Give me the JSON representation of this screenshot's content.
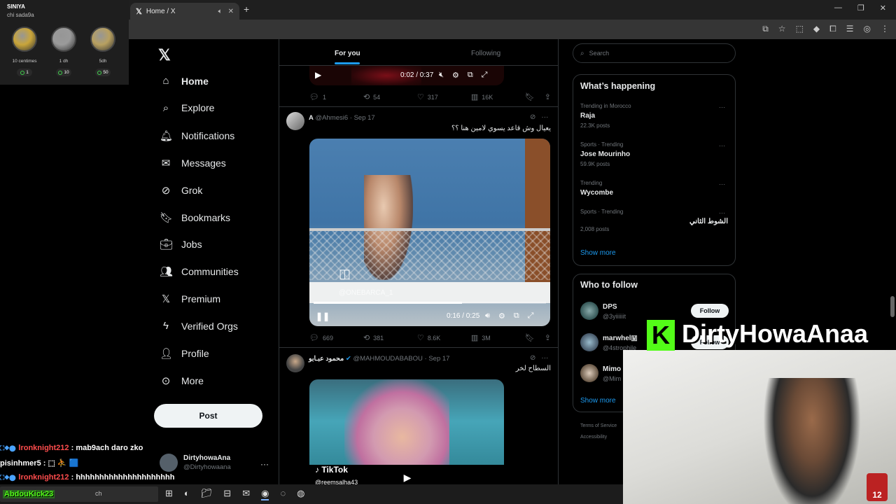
{
  "browser": {
    "tab_title": "Home / X",
    "tab_logo": "𝕏",
    "new_tab": "+",
    "window_controls": [
      "—",
      "❐",
      "✕"
    ]
  },
  "sidebar": {
    "logo": "𝕏",
    "items": [
      {
        "label": "Home",
        "icon": "home-icon",
        "glyph": "⌂",
        "active": true
      },
      {
        "label": "Explore",
        "icon": "search-icon",
        "glyph": "⌕"
      },
      {
        "label": "Notifications",
        "icon": "bell-icon",
        "glyph": "🔔︎"
      },
      {
        "label": "Messages",
        "icon": "mail-icon",
        "glyph": "✉"
      },
      {
        "label": "Grok",
        "icon": "grok-icon",
        "glyph": "⊘"
      },
      {
        "label": "Bookmarks",
        "icon": "bookmark-icon",
        "glyph": "🔖︎"
      },
      {
        "label": "Jobs",
        "icon": "briefcase-icon",
        "glyph": "💼︎"
      },
      {
        "label": "Communities",
        "icon": "people-icon",
        "glyph": "👥︎"
      },
      {
        "label": "Premium",
        "icon": "x-premium-icon",
        "glyph": "𝕏"
      },
      {
        "label": "Verified Orgs",
        "icon": "lightning-icon",
        "glyph": "ϟ"
      },
      {
        "label": "Profile",
        "icon": "person-icon",
        "glyph": "👤︎"
      },
      {
        "label": "More",
        "icon": "more-circle-icon",
        "glyph": "⊙"
      }
    ],
    "post_button": "Post",
    "account": {
      "name": "DirtyhowaAna",
      "handle": "@Dirtyhowaana",
      "more": "···"
    }
  },
  "feed": {
    "tabs": [
      {
        "label": "For you",
        "active": true
      },
      {
        "label": "Following"
      }
    ],
    "tweet1": {
      "video_time": "0:02 / 0:37",
      "actions": {
        "replies": "1",
        "reposts": "54",
        "likes": "317",
        "views": "16K"
      }
    },
    "tweet2": {
      "name": "A",
      "handle": "@Ahmesi6",
      "date": "Sep 17",
      "text": "يعيال وش قاعد يسوي لامين هنا ؟؟",
      "watermark": "@ONEBARCA_1",
      "video_time": "0:16 / 0:25",
      "progress": 0.64,
      "actions": {
        "replies": "669",
        "reposts": "381",
        "likes": "8.6K",
        "views": "3M"
      }
    },
    "tweet3": {
      "name": "محمود عبـابو",
      "handle": "@MAHMOUDABABOU",
      "date": "Sep 17",
      "text": "السطاح لخر",
      "tiktok": "TikTok",
      "tiktok_handle": "@reemsalha43"
    }
  },
  "right": {
    "search_placeholder": "Search",
    "trends": {
      "title": "What’s happening",
      "items": [
        {
          "context": "Trending in Morocco",
          "name": "Raja",
          "count": "22.3K posts"
        },
        {
          "context": "Sports · Trending",
          "name": "Jose Mourinho",
          "count": "59.9K posts"
        },
        {
          "context": "Trending",
          "name": "Wycombe",
          "count": ""
        },
        {
          "context": "Sports · Trending",
          "name": "الشوط الثاني",
          "count": "2,008 posts"
        }
      ],
      "show_more": "Show more"
    },
    "who_to_follow": {
      "title": "Who to follow",
      "items": [
        {
          "name": "DPS",
          "handle": "@3yiiiiiit",
          "button": "Follow"
        },
        {
          "name": "marwhel🇲",
          "handle": "@4strophile",
          "button": "Follow"
        },
        {
          "name": "Mimo",
          "handle": "@Mim",
          "button": ""
        }
      ],
      "show_more": "Show more"
    },
    "footer": [
      "Terms of Service",
      "Accessibility"
    ]
  },
  "overlay": {
    "coins": {
      "user": "SINIYA",
      "subtitle": "chi sada9a",
      "items": [
        {
          "label": "10 centimes",
          "count": "1",
          "color": "#c9a53a"
        },
        {
          "label": "1 dh",
          "count": "10",
          "color": "#9a9a9a"
        },
        {
          "label": "5dh",
          "count": "50",
          "color": "#b8a060"
        }
      ]
    },
    "chat": [
      {
        "user": "lronknight212",
        "text": ": mab9ach daro zko",
        "color": "#ff4d4d"
      },
      {
        "user": "pisinhmer5",
        "text": ": ⬚ ⛹ 🟦",
        "color": "#ffffff"
      },
      {
        "user": "lronknight212",
        "text": ": hhhhhhhhhhhhhhhhhhhhh",
        "color": "#ff4d4d"
      }
    ],
    "kick_name": "DirtyHowaAnaa",
    "kick_logo": "K",
    "cam_badge": "12",
    "abdou": "AbdouKick23"
  },
  "taskbar": {
    "search_text": "ch"
  }
}
